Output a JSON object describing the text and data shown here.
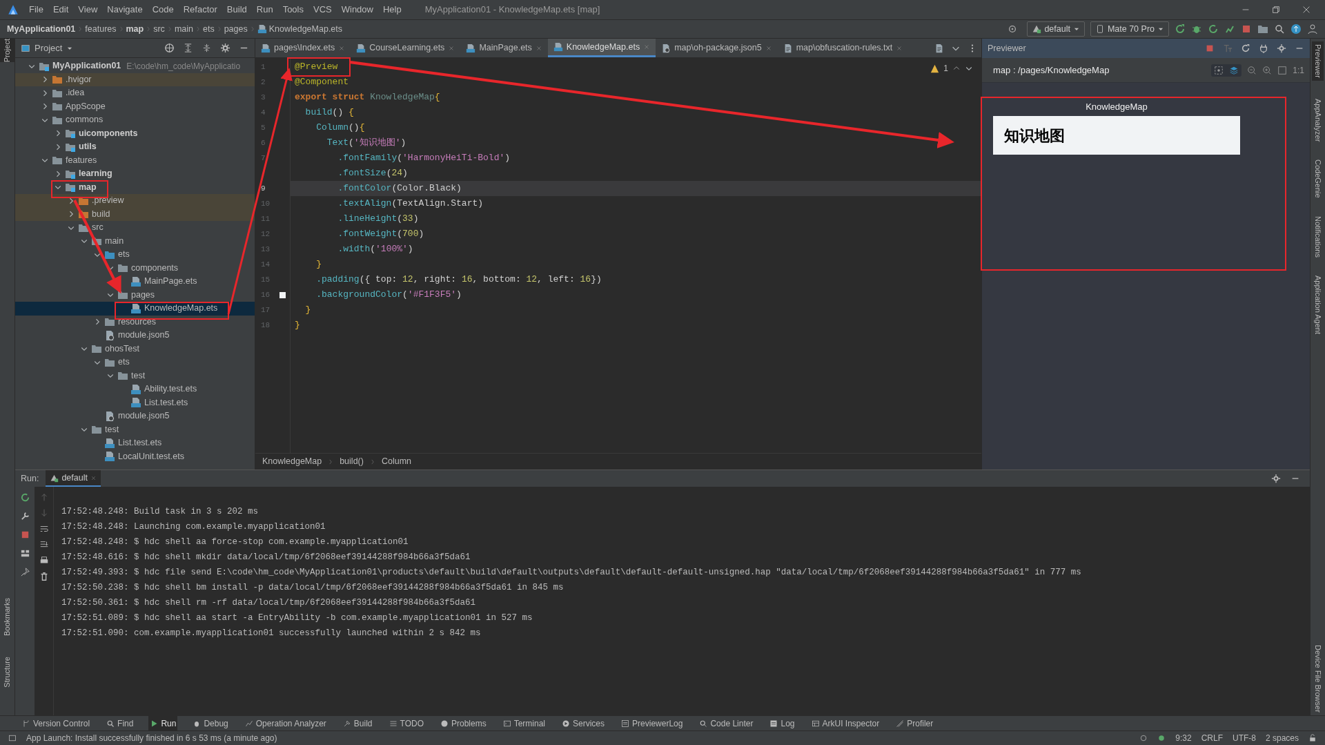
{
  "menu": [
    "File",
    "Edit",
    "View",
    "Navigate",
    "Code",
    "Refactor",
    "Build",
    "Run",
    "Tools",
    "VCS",
    "Window",
    "Help"
  ],
  "window": {
    "title": "MyApplication01 - KnowledgeMap.ets [map]"
  },
  "breadcrumb": [
    {
      "text": "MyApplication01",
      "bold": true
    },
    {
      "text": "features",
      "bold": false
    },
    {
      "text": "map",
      "bold": true
    },
    {
      "text": "src",
      "bold": false
    },
    {
      "text": "main",
      "bold": false
    },
    {
      "text": "ets",
      "bold": false
    },
    {
      "text": "pages",
      "bold": false
    },
    {
      "text": "KnowledgeMap.ets",
      "bold": false
    }
  ],
  "run_config": "default",
  "device": "Mate 70 Pro",
  "left_stripe": [
    "Project",
    "Bookmarks",
    "Structure"
  ],
  "project": {
    "title": "Project",
    "tree": [
      {
        "name": "MyApplication01",
        "path": "E:\\code\\hm_code\\MyApplicatio",
        "kind": "module",
        "expanded": true,
        "selected": false,
        "children": [
          {
            "name": ".hvigor",
            "kind": "excluded",
            "expanded": false,
            "selected": false
          },
          {
            "name": ".idea",
            "kind": "folder",
            "expanded": false,
            "selected": false
          },
          {
            "name": "AppScope",
            "kind": "folder",
            "expanded": false,
            "selected": false
          },
          {
            "name": "commons",
            "kind": "folder",
            "expanded": true,
            "selected": false,
            "children": [
              {
                "name": "uicomponents",
                "kind": "module",
                "expanded": false,
                "selected": false
              },
              {
                "name": "utils",
                "kind": "module",
                "expanded": false,
                "selected": false
              }
            ]
          },
          {
            "name": "features",
            "kind": "folder",
            "expanded": true,
            "selected": false,
            "children": [
              {
                "name": "learning",
                "kind": "module",
                "expanded": false,
                "selected": false
              },
              {
                "name": "map",
                "kind": "module",
                "expanded": true,
                "selected": false,
                "children": [
                  {
                    "name": ".preview",
                    "kind": "excluded",
                    "expanded": false,
                    "selected": false
                  },
                  {
                    "name": "build",
                    "kind": "excluded",
                    "expanded": false,
                    "selected": false
                  },
                  {
                    "name": "src",
                    "kind": "folder",
                    "expanded": true,
                    "selected": false,
                    "children": [
                      {
                        "name": "main",
                        "kind": "folder",
                        "expanded": true,
                        "selected": false,
                        "children": [
                          {
                            "name": "ets",
                            "kind": "source",
                            "expanded": true,
                            "selected": false,
                            "children": [
                              {
                                "name": "components",
                                "kind": "folder",
                                "expanded": true,
                                "selected": false,
                                "children": [
                                  {
                                    "name": "MainPage.ets",
                                    "kind": "ets",
                                    "selected": false
                                  }
                                ]
                              },
                              {
                                "name": "pages",
                                "kind": "folder",
                                "expanded": true,
                                "selected": false,
                                "children": [
                                  {
                                    "name": "KnowledgeMap.ets",
                                    "kind": "ets",
                                    "selected": true
                                  }
                                ]
                              }
                            ]
                          },
                          {
                            "name": "resources",
                            "kind": "folder",
                            "expanded": false,
                            "selected": false
                          },
                          {
                            "name": "module.json5",
                            "kind": "json",
                            "selected": false
                          }
                        ]
                      },
                      {
                        "name": "ohosTest",
                        "kind": "folder",
                        "expanded": true,
                        "selected": false,
                        "children": [
                          {
                            "name": "ets",
                            "kind": "folder",
                            "expanded": true,
                            "selected": false,
                            "children": [
                              {
                                "name": "test",
                                "kind": "folder",
                                "expanded": true,
                                "selected": false,
                                "children": [
                                  {
                                    "name": "Ability.test.ets",
                                    "kind": "ets",
                                    "selected": false
                                  },
                                  {
                                    "name": "List.test.ets",
                                    "kind": "ets",
                                    "selected": false
                                  }
                                ]
                              }
                            ]
                          },
                          {
                            "name": "module.json5",
                            "kind": "json",
                            "selected": false
                          }
                        ]
                      },
                      {
                        "name": "test",
                        "kind": "folder",
                        "expanded": true,
                        "selected": false,
                        "children": [
                          {
                            "name": "List.test.ets",
                            "kind": "ets",
                            "selected": false
                          },
                          {
                            "name": "LocalUnit.test.ets",
                            "kind": "ets",
                            "selected": false
                          }
                        ]
                      }
                    ]
                  }
                ]
              }
            ]
          }
        ]
      }
    ]
  },
  "tabs": [
    {
      "label": "pages\\Index.ets",
      "kind": "ets",
      "selected": false
    },
    {
      "label": "CourseLearning.ets",
      "kind": "ets",
      "selected": false
    },
    {
      "label": "MainPage.ets",
      "kind": "ets",
      "selected": false
    },
    {
      "label": "KnowledgeMap.ets",
      "kind": "ets",
      "selected": true
    },
    {
      "label": "map\\oh-package.json5",
      "kind": "json",
      "selected": false
    },
    {
      "label": "map\\obfuscation-rules.txt",
      "kind": "txt",
      "selected": false
    }
  ],
  "editor": {
    "warnings": "1",
    "lines": [
      {
        "number": "1",
        "current": false,
        "tokens": [
          {
            "kind": "decorator",
            "text": "@Preview"
          }
        ]
      },
      {
        "number": "2",
        "current": false,
        "tokens": [
          {
            "kind": "decorator",
            "text": "@Component"
          }
        ]
      },
      {
        "number": "3",
        "current": false,
        "tokens": [
          {
            "kind": "keyword",
            "text": "export struct "
          },
          {
            "kind": "type",
            "text": "KnowledgeMap"
          },
          {
            "kind": "brace",
            "text": "{"
          }
        ]
      },
      {
        "number": "4",
        "current": false,
        "tokens": [
          {
            "kind": "func",
            "text": "  build"
          },
          {
            "kind": "plain",
            "text": "() "
          },
          {
            "kind": "brace",
            "text": "{"
          }
        ]
      },
      {
        "number": "5",
        "current": false,
        "tokens": [
          {
            "kind": "func",
            "text": "    Column"
          },
          {
            "kind": "plain",
            "text": "()"
          },
          {
            "kind": "brace",
            "text": "{"
          }
        ]
      },
      {
        "number": "6",
        "current": false,
        "tokens": [
          {
            "kind": "func",
            "text": "      Text"
          },
          {
            "kind": "plain",
            "text": "("
          },
          {
            "kind": "string",
            "text": "'知识地图'"
          },
          {
            "kind": "plain",
            "text": ")"
          }
        ]
      },
      {
        "number": "7",
        "current": false,
        "tokens": [
          {
            "kind": "func",
            "text": "        .fontFamily"
          },
          {
            "kind": "plain",
            "text": "("
          },
          {
            "kind": "string",
            "text": "'HarmonyHeiTi-Bold'"
          },
          {
            "kind": "plain",
            "text": ")"
          }
        ]
      },
      {
        "current": false,
        "tokens": [
          {
            "kind": "func",
            "text": "        .fontSize"
          },
          {
            "kind": "plain",
            "text": "("
          },
          {
            "kind": "number",
            "text": "24"
          },
          {
            "kind": "plain",
            "text": ")"
          }
        ]
      },
      {
        "number": "9",
        "current": true,
        "tokens": [
          {
            "kind": "func",
            "text": "        .fontColor"
          },
          {
            "kind": "plain",
            "text": "(Color.Black)"
          }
        ]
      },
      {
        "number": "10",
        "current": false,
        "tokens": [
          {
            "kind": "func",
            "text": "        .textAlign"
          },
          {
            "kind": "plain",
            "text": "(TextAlign.Start)"
          }
        ]
      },
      {
        "number": "11",
        "current": false,
        "tokens": [
          {
            "kind": "func",
            "text": "        .lineHeight"
          },
          {
            "kind": "plain",
            "text": "("
          },
          {
            "kind": "number",
            "text": "33"
          },
          {
            "kind": "plain",
            "text": ")"
          }
        ]
      },
      {
        "number": "12",
        "current": false,
        "tokens": [
          {
            "kind": "func",
            "text": "        .fontWeight"
          },
          {
            "kind": "plain",
            "text": "("
          },
          {
            "kind": "number",
            "text": "700"
          },
          {
            "kind": "plain",
            "text": ")"
          }
        ]
      },
      {
        "number": "13",
        "current": false,
        "tokens": [
          {
            "kind": "func",
            "text": "        .width"
          },
          {
            "kind": "plain",
            "text": "("
          },
          {
            "kind": "string",
            "text": "'100%'"
          },
          {
            "kind": "plain",
            "text": ")"
          }
        ]
      },
      {
        "number": "14",
        "current": false,
        "tokens": [
          {
            "kind": "brace",
            "text": "    }"
          }
        ]
      },
      {
        "number": "15",
        "current": false,
        "tokens": [
          {
            "kind": "func",
            "text": "    .padding"
          },
          {
            "kind": "plain",
            "text": "({ top: "
          },
          {
            "kind": "number",
            "text": "12"
          },
          {
            "kind": "plain",
            "text": ", right: "
          },
          {
            "kind": "number",
            "text": "16"
          },
          {
            "kind": "plain",
            "text": ", bottom: "
          },
          {
            "kind": "number",
            "text": "12"
          },
          {
            "kind": "plain",
            "text": ", left: "
          },
          {
            "kind": "number",
            "text": "16"
          },
          {
            "kind": "plain",
            "text": "})"
          }
        ]
      },
      {
        "number": "16",
        "current": false,
        "tokens": [
          {
            "kind": "func",
            "text": "    .backgroundColor"
          },
          {
            "kind": "plain",
            "text": "("
          },
          {
            "kind": "string",
            "text": "'#F1F3F5'"
          },
          {
            "kind": "plain",
            "text": ")"
          }
        ]
      },
      {
        "number": "17",
        "current": false,
        "tokens": [
          {
            "kind": "brace",
            "text": "  }"
          }
        ]
      },
      {
        "number": "18",
        "current": false,
        "tokens": [
          {
            "kind": "brace",
            "text": "}"
          }
        ]
      }
    ],
    "path": [
      "KnowledgeMap",
      "build()",
      "Column"
    ]
  },
  "previewer": {
    "title": "Previewer",
    "route": "map : /pages/KnowledgeMap",
    "zoom_label": "1:1",
    "page_title": "KnowledgeMap",
    "text": "知识地图"
  },
  "right_stripe": [
    "Previewer",
    "AppAnalyzer",
    "CodeGenie",
    "Notifications",
    "Application Agent",
    "Device File Browser"
  ],
  "run": {
    "label": "Run:",
    "tab": "default",
    "log": [
      "17:52:48.248: Build task in 3 s 202 ms",
      "17:52:48.248: Launching com.example.myapplication01",
      "17:52:48.248: $ hdc shell aa force-stop com.example.myapplication01",
      "17:52:48.616: $ hdc shell mkdir data/local/tmp/6f2068eef39144288f984b66a3f5da61",
      "17:52:49.393: $ hdc file send E:\\code\\hm_code\\MyApplication01\\products\\default\\build\\default\\outputs\\default\\default-default-unsigned.hap \"data/local/tmp/6f2068eef39144288f984b66a3f5da61\" in 777 ms",
      "17:52:50.238: $ hdc shell bm install -p data/local/tmp/6f2068eef39144288f984b66a3f5da61 in 845 ms",
      "17:52:50.361: $ hdc shell rm -rf data/local/tmp/6f2068eef39144288f984b66a3f5da61",
      "17:52:51.089: $ hdc shell aa start -a EntryAbility -b com.example.myapplication01 in 527 ms",
      "17:52:51.090: com.example.myapplication01 successfully launched within 2 s 842 ms"
    ]
  },
  "tool_windows": [
    {
      "label": "Version Control",
      "selected": false
    },
    {
      "label": "Find",
      "selected": false
    },
    {
      "label": "Run",
      "selected": true
    },
    {
      "label": "Debug",
      "selected": false
    },
    {
      "label": "Operation Analyzer",
      "selected": false
    },
    {
      "label": "Build",
      "selected": false
    },
    {
      "label": "TODO",
      "selected": false
    },
    {
      "label": "Problems",
      "selected": false
    },
    {
      "label": "Terminal",
      "selected": false
    },
    {
      "label": "Services",
      "selected": false
    },
    {
      "label": "PreviewerLog",
      "selected": false
    },
    {
      "label": "Code Linter",
      "selected": false
    },
    {
      "label": "Log",
      "selected": false
    },
    {
      "label": "ArkUI Inspector",
      "selected": false
    },
    {
      "label": "Profiler",
      "selected": false
    }
  ],
  "status_bar": {
    "message": "App Launch: Install successfully finished in 6 s 53 ms (a minute ago)",
    "position": "9:32",
    "line_ending": "CRLF",
    "encoding": "UTF-8",
    "indent": "2 spaces"
  }
}
